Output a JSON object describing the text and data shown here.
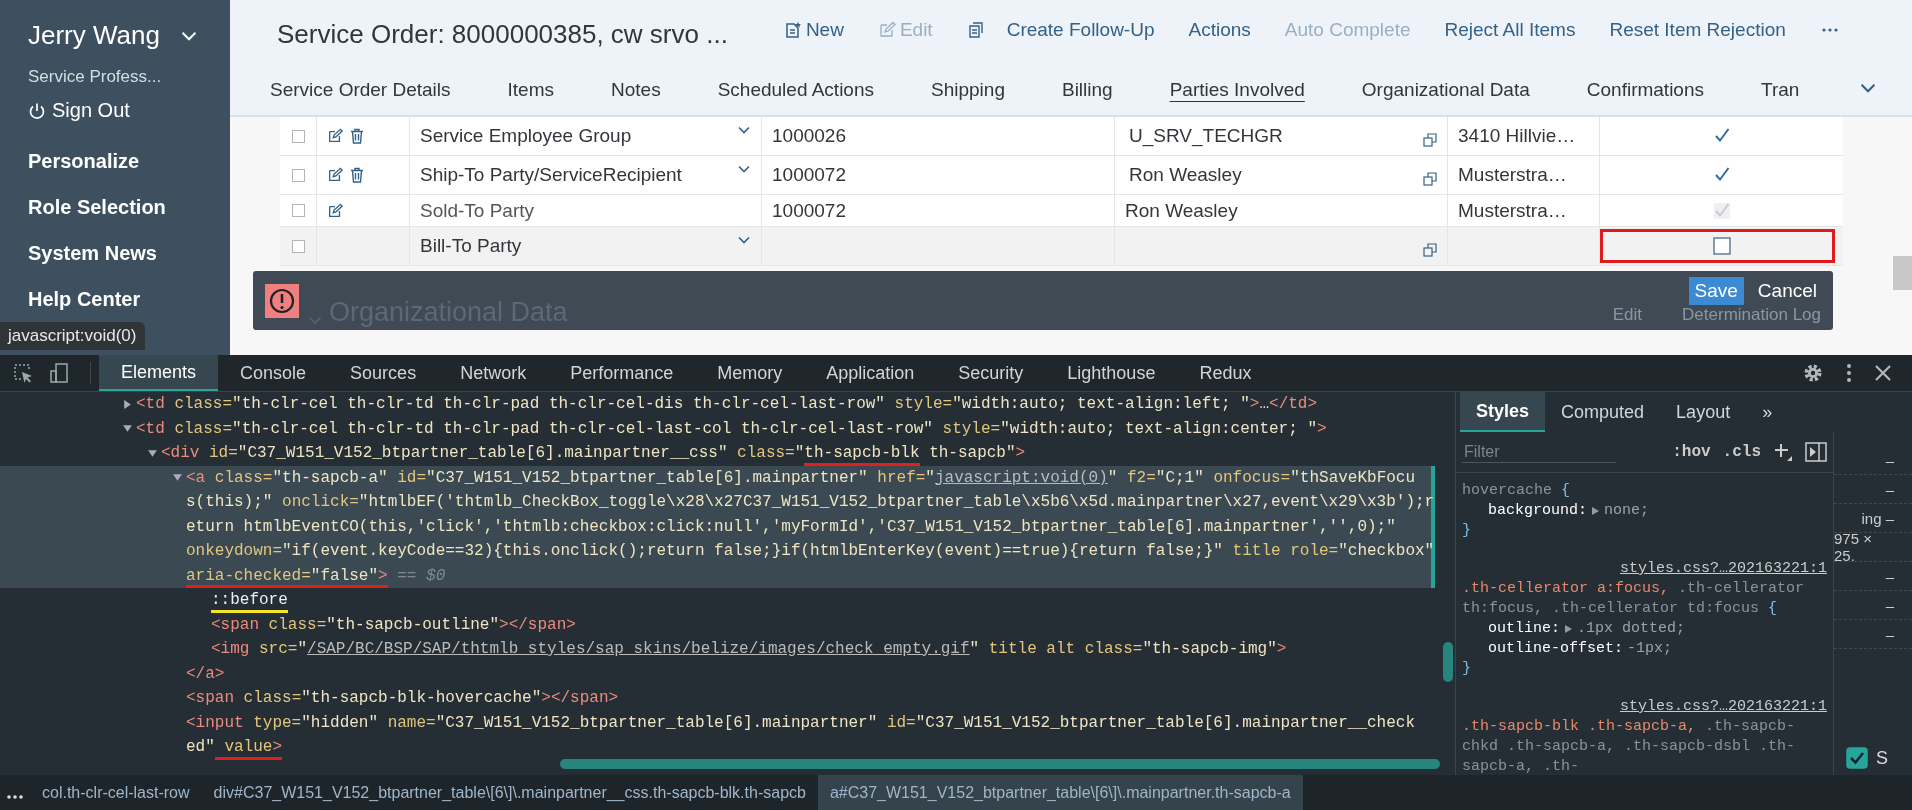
{
  "sidebar": {
    "user": "Jerry Wang",
    "role": "Service Profess...",
    "sign_out": "Sign Out",
    "items": [
      "Personalize",
      "Role Selection",
      "System News",
      "Help Center"
    ]
  },
  "tooltip": "javascript:void(0)",
  "header": {
    "title": "Service Order: 8000000385, cw srvo ...",
    "actions": [
      {
        "label": "New",
        "kind": "new",
        "disabled": false
      },
      {
        "label": "Edit",
        "kind": "edit",
        "disabled": true
      },
      {
        "label": "Create Follow-Up",
        "kind": "copy",
        "disabled": false
      },
      {
        "label": "Actions",
        "disabled": false
      },
      {
        "label": "Auto Complete",
        "disabled": true
      },
      {
        "label": "Reject All Items",
        "disabled": false
      },
      {
        "label": "Reset Item Rejection",
        "disabled": false
      }
    ]
  },
  "tabs": [
    {
      "label": "Service Order Details",
      "selected": false
    },
    {
      "label": "Items",
      "selected": false
    },
    {
      "label": "Notes",
      "selected": false
    },
    {
      "label": "Scheduled Actions",
      "selected": false
    },
    {
      "label": "Shipping",
      "selected": false
    },
    {
      "label": "Billing",
      "selected": false
    },
    {
      "label": "Parties Involved",
      "selected": true
    },
    {
      "label": "Organizational Data",
      "selected": false
    },
    {
      "label": "Confirmations",
      "selected": false
    },
    {
      "label": "Tran",
      "selected": false
    }
  ],
  "table": {
    "rows": [
      {
        "checked": false,
        "tools": [
          {
            "kind": "edit"
          },
          {
            "kind": "delete"
          }
        ],
        "function": "Service Employee Group",
        "dropdown": true,
        "number": "1000026",
        "name": "U_SRV_TECHGR",
        "link": true,
        "address": "3410 Hillvie…",
        "main": true,
        "editable": true,
        "current": false,
        "outlined": false
      },
      {
        "checked": false,
        "tools": [
          {
            "kind": "edit"
          },
          {
            "kind": "delete"
          }
        ],
        "function": "Ship-To Party/ServiceRecipient",
        "dropdown": true,
        "number": "1000072",
        "name": "Ron Weasley",
        "link": true,
        "address": "Musterstra…",
        "main": true,
        "editable": true,
        "current": false,
        "outlined": false
      },
      {
        "checked": false,
        "tools": [
          {
            "kind": "edit"
          }
        ],
        "function": "Sold-To Party",
        "dropdown": false,
        "number": "1000072",
        "name": "Ron Weasley",
        "link": false,
        "address": "Musterstra…",
        "main": true,
        "editable": false,
        "current": false,
        "outlined": false
      },
      {
        "checked": false,
        "function": "Bill-To Party",
        "dropdown": true,
        "link": true,
        "main": false,
        "editable": true,
        "current": true,
        "outlined": true
      }
    ]
  },
  "footer": {
    "section": "Organizational Data",
    "edit": "Edit",
    "log": "Determination Log",
    "save": "Save",
    "cancel": "Cancel"
  },
  "devtools": {
    "tabs": [
      {
        "label": "Elements",
        "selected": true
      },
      {
        "label": "Console",
        "selected": false
      },
      {
        "label": "Sources",
        "selected": false
      },
      {
        "label": "Network",
        "selected": false
      },
      {
        "label": "Performance",
        "selected": false
      },
      {
        "label": "Memory",
        "selected": false
      },
      {
        "label": "Application",
        "selected": false
      },
      {
        "label": "Security",
        "selected": false
      },
      {
        "label": "Lighthouse",
        "selected": false
      },
      {
        "label": "Redux",
        "selected": false
      }
    ],
    "tree": [
      {
        "expanded": false,
        "lines": [
          [
            {
              "kind": "tag",
              "t": "<td"
            },
            {
              "kind": "attr",
              "t": " class="
            },
            {
              "kind": "val",
              "t": "\"th-clr-cel th-clr-td th-clr-pad th-clr-cel-dis th-clr-cel-last-row\""
            },
            {
              "kind": "attr",
              "t": " style="
            },
            {
              "kind": "val",
              "t": "\"width:auto; text-align:left; \""
            },
            {
              "kind": "tag",
              "t": ">"
            },
            {
              "kind": "txt",
              "t": "…"
            },
            {
              "kind": "tag",
              "t": "</td>"
            }
          ]
        ]
      },
      {
        "expanded": true,
        "lines": [
          [
            {
              "kind": "tag",
              "t": "<td"
            },
            {
              "kind": "attr",
              "t": " class="
            },
            {
              "kind": "val",
              "t": "\"th-clr-cel th-clr-td th-clr-pad th-clr-cel-last-col th-clr-cel-last-row\""
            },
            {
              "kind": "attr",
              "t": " style="
            },
            {
              "kind": "val",
              "t": "\"width:auto; text-align:center; \""
            },
            {
              "kind": "tag",
              "t": ">"
            }
          ]
        ],
        "children": [
          {
            "expanded": true,
            "lines": [
              [
                {
                  "kind": "tag",
                  "t": "<div"
                },
                {
                  "kind": "attr",
                  "t": " id="
                },
                {
                  "kind": "val",
                  "t": "\"C37_W151_V152_btpartner_table[6].mainpartner__css\""
                },
                {
                  "kind": "attr",
                  "t": " class="
                },
                {
                  "kind": "val",
                  "t": "\""
                },
                {
                  "kind": "val",
                  "t": "th-sapcb-blk",
                  "color": "#e0201b"
                },
                {
                  "kind": "val",
                  "t": " th-sapcb\""
                },
                {
                  "kind": "tag",
                  "t": ">"
                }
              ]
            ],
            "children": [
              {
                "expanded": true,
                "selected": true,
                "lines": [
                  [
                    {
                      "kind": "tag",
                      "t": "<a"
                    },
                    {
                      "kind": "attr",
                      "t": " class="
                    },
                    {
                      "kind": "val",
                      "t": "\"th-sapcb-a\""
                    },
                    {
                      "kind": "attr",
                      "t": " id="
                    },
                    {
                      "kind": "val",
                      "t": "\"C37_W151_V152_btpartner_table[6].mainpartner\""
                    },
                    {
                      "kind": "attr",
                      "t": " href="
                    },
                    {
                      "kind": "val",
                      "t": "\""
                    },
                    {
                      "kind": "link",
                      "t": "javascript:void(0)"
                    },
                    {
                      "kind": "val",
                      "t": "\""
                    },
                    {
                      "kind": "attr",
                      "t": " f2="
                    },
                    {
                      "kind": "val",
                      "t": "\"C;1\""
                    },
                    {
                      "kind": "attr",
                      "t": " onfocus="
                    },
                    {
                      "kind": "val",
                      "t": "\"thSaveKbFocu"
                    }
                  ],
                  [
                    {
                      "kind": "val",
                      "t": "s(this);\""
                    },
                    {
                      "kind": "attr",
                      "t": " onclick="
                    },
                    {
                      "kind": "val",
                      "t": "\"htmlbEF('thtmlb_CheckBox_toggle\\x28\\x27C37_W151_V152_btpartner_table\\x5b6\\x5d.mainpartner\\x27,event\\x29\\x3b');r"
                    }
                  ],
                  [
                    {
                      "kind": "val",
                      "t": "eturn htmlbEventCO(this,'click','thtmlb:checkbox:click:null','myFormId','C37_W151_V152_btpartner_table[6].mainpartner','',0);\""
                    }
                  ],
                  [
                    {
                      "kind": "attr",
                      "t": "onkeydown="
                    },
                    {
                      "kind": "val",
                      "t": "\"if(event.keyCode==32){this.onclick();return false;}if(htmlbEnterKey(event)==true){return false;}\""
                    },
                    {
                      "kind": "attr",
                      "t": " title role="
                    },
                    {
                      "kind": "val",
                      "t": "\"checkbox\""
                    }
                  ],
                  [
                    {
                      "kind": "attr",
                      "t": "aria-checked=",
                      "color": "#e0201b"
                    },
                    {
                      "kind": "val",
                      "t": "\"false\"",
                      "color": "#e0201b"
                    },
                    {
                      "kind": "tag",
                      "t": ">",
                      "color": "#e0201b"
                    },
                    {
                      "kind": "ref",
                      "t": " == $0"
                    }
                  ]
                ],
                "close": [
                  {
                    "kind": "tag",
                    "t": "</a>"
                  }
                ],
                "children": [
                  {
                    "lines": [
                      [
                        {
                          "kind": "pseudo",
                          "t": "::before",
                          "color": "#f2e22a"
                        }
                      ]
                    ]
                  },
                  {
                    "lines": [
                      [
                        {
                          "kind": "tag",
                          "t": "<span"
                        },
                        {
                          "kind": "attr",
                          "t": " class="
                        },
                        {
                          "kind": "val",
                          "t": "\"th-sapcb-outline\""
                        },
                        {
                          "kind": "tag",
                          "t": "></span>"
                        }
                      ]
                    ]
                  },
                  {
                    "lines": [
                      [
                        {
                          "kind": "tag",
                          "t": "<img"
                        },
                        {
                          "kind": "attr",
                          "t": " src="
                        },
                        {
                          "kind": "val",
                          "t": "\""
                        },
                        {
                          "kind": "link",
                          "t": "/SAP/BC/BSP/SAP/thtmlb_styles/sap_skins/belize/images/check_empty.gif"
                        },
                        {
                          "kind": "val",
                          "t": "\""
                        },
                        {
                          "kind": "attr",
                          "t": " title alt class="
                        },
                        {
                          "kind": "val",
                          "t": "\"th-sapcb-img\""
                        },
                        {
                          "kind": "tag",
                          "t": ">"
                        }
                      ]
                    ]
                  }
                ]
              },
              {
                "lines": [
                  [
                    {
                      "kind": "tag",
                      "t": "<span"
                    },
                    {
                      "kind": "attr",
                      "t": " class="
                    },
                    {
                      "kind": "val",
                      "t": "\"th-sapcb-blk-hovercache\""
                    },
                    {
                      "kind": "tag",
                      "t": "></span>"
                    }
                  ]
                ]
              },
              {
                "lines": [
                  [
                    {
                      "kind": "tag",
                      "t": "<input"
                    },
                    {
                      "kind": "attr",
                      "t": " type="
                    },
                    {
                      "kind": "val",
                      "t": "\"hidden\""
                    },
                    {
                      "kind": "attr",
                      "t": " name="
                    },
                    {
                      "kind": "val",
                      "t": "\"C37_W151_V152_btpartner_table[6].mainpartner\""
                    },
                    {
                      "kind": "attr",
                      "t": " id="
                    },
                    {
                      "kind": "val",
                      "t": "\"C37_W151_V152_btpartner_table[6].mainpartner__check"
                    }
                  ],
                  [
                    {
                      "kind": "val",
                      "t": "ed\""
                    },
                    {
                      "kind": "attr",
                      "t": " value",
                      "color": "#e0201b"
                    },
                    {
                      "kind": "tag",
                      "t": ">",
                      "color": "#e0201b"
                    }
                  ]
                ]
              }
            ]
          }
        ]
      }
    ],
    "styles": {
      "tabs": [
        {
          "label": "Styles",
          "selected": true
        },
        {
          "label": "Computed",
          "selected": false
        },
        {
          "label": "Layout",
          "selected": false
        },
        {
          "label": "»",
          "selected": false
        }
      ],
      "filter_placeholder": "Filter",
      "hov": ":hov",
      "cls": ".cls",
      "rules": [
        {
          "selector": [
            {
              "kind": "faded",
              "t": "hovercache"
            }
          ],
          "open": "{",
          "props": [
            {
              "name": "background:",
              "value": "none;",
              "expander": true
            }
          ],
          "close": "}"
        },
        {
          "selector": [
            {
              "kind": "match",
              "t": ".th-cellerator a:focus,"
            },
            {
              "kind": "other",
              "t": " .th-cellerator th:focus, .th-cellerator td:focus"
            }
          ],
          "open": "{",
          "source": "styles.css?…202163221:1",
          "props": [
            {
              "name": "outline:",
              "value": ".1px dotted;",
              "expander": true
            },
            {
              "name": "outline-offset:",
              "value": "-1px;",
              "expander": false
            }
          ],
          "close": "}"
        },
        {
          "selector": [
            {
              "kind": "match",
              "t": ".th-sapcb-blk .th-sapcb-a,"
            },
            {
              "kind": "other",
              "t": " .th-sapcb-chkd .th-sapcb-a, .th-sapcb-dsbl .th-sapcb-a, .th-"
            }
          ],
          "source": "styles.css?…202163221:1"
        }
      ]
    },
    "side_strip": [
      "–",
      "–",
      "ing –",
      "975 × 25.",
      "–",
      "–",
      "–"
    ],
    "side_check": {
      "checked": true,
      "label": "S"
    },
    "breadcrumbs": [
      {
        "text": "col.th-clr-cel-last-row",
        "selected": false
      },
      {
        "text": "div#C37_W151_V152_btpartner_table\\[6\\]\\.mainpartner__css.th-sapcb-blk.th-sapcb",
        "selected": false
      },
      {
        "text": "a#C37_W151_V152_btpartner_table\\[6\\]\\.mainpartner.th-sapcb-a",
        "selected": true
      }
    ]
  }
}
